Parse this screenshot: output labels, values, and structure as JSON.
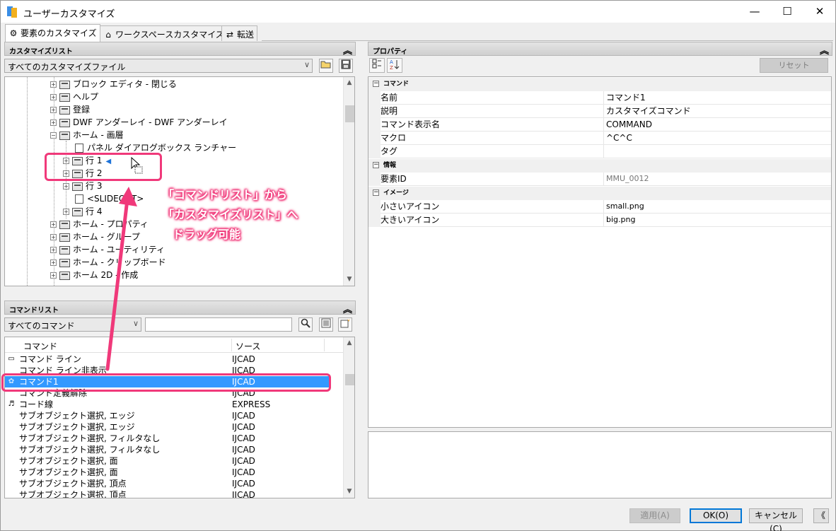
{
  "window": {
    "title": "ユーザーカスタマイズ",
    "min": "—",
    "max": "☐",
    "close": "✕"
  },
  "tabs": [
    {
      "label": "要素のカスタマイズ",
      "icon": "⚙"
    },
    {
      "label": "ワークスペースカスタマイズ",
      "icon": "⌂"
    },
    {
      "label": "転送",
      "icon": "⇄"
    }
  ],
  "customize_panel": {
    "title": "カスタマイズリスト",
    "collapse": "︽",
    "file_select": "すべてのカスタマイズファイル",
    "tree": [
      {
        "label": "ブロック エディタ - 閉じる",
        "pm": "+"
      },
      {
        "label": "ヘルプ",
        "pm": "+"
      },
      {
        "label": "登録",
        "pm": "+"
      },
      {
        "label": "DWF アンダーレイ - DWF アンダーレイ",
        "pm": "+"
      },
      {
        "label": "ホーム - 画層",
        "pm": "−"
      },
      {
        "label": "パネル ダイアログボックス ランチャー",
        "pm": ""
      },
      {
        "label": "行 1",
        "pm": "+"
      },
      {
        "label": "行 2",
        "pm": "+"
      },
      {
        "label": "行 3",
        "pm": "+"
      },
      {
        "label": "<SLIDEOUT>",
        "pm": ""
      },
      {
        "label": "行 4",
        "pm": "+"
      },
      {
        "label": "ホーム - プロパティ",
        "pm": "+"
      },
      {
        "label": "ホーム - グループ",
        "pm": "+"
      },
      {
        "label": "ホーム - ユーティリティ",
        "pm": "+"
      },
      {
        "label": "ホーム - クリップボード",
        "pm": "+"
      },
      {
        "label": "ホーム 2D - 作成",
        "pm": "+"
      }
    ]
  },
  "command_panel": {
    "title": "コマンドリスト",
    "collapse": "︽",
    "filter": "すべてのコマンド",
    "search_value": "",
    "columns": {
      "command": "コマンド",
      "source": "ソース"
    },
    "rows": [
      {
        "name": "コマンド ライン",
        "source": "IJCAD",
        "icon": "▭"
      },
      {
        "name": "コマンド ライン非表示",
        "source": "IJCAD",
        "icon": ""
      },
      {
        "name": "コマンド1",
        "source": "IJCAD",
        "icon": "✿",
        "selected": true
      },
      {
        "name": "コマンド定義解除",
        "source": "IJCAD",
        "icon": ""
      },
      {
        "name": "コード線",
        "source": "EXPRESS",
        "icon": "♬"
      },
      {
        "name": "サブオブジェクト選択, エッジ",
        "source": "IJCAD",
        "icon": ""
      },
      {
        "name": "サブオブジェクト選択, エッジ",
        "source": "IJCAD",
        "icon": ""
      },
      {
        "name": "サブオブジェクト選択, フィルタなし",
        "source": "IJCAD",
        "icon": ""
      },
      {
        "name": "サブオブジェクト選択, フィルタなし",
        "source": "IJCAD",
        "icon": ""
      },
      {
        "name": "サブオブジェクト選択, 面",
        "source": "IJCAD",
        "icon": ""
      },
      {
        "name": "サブオブジェクト選択, 面",
        "source": "IJCAD",
        "icon": ""
      },
      {
        "name": "サブオブジェクト選択, 頂点",
        "source": "IJCAD",
        "icon": ""
      },
      {
        "name": "サブオブジェクト選択, 頂点",
        "source": "IJCAD",
        "icon": ""
      }
    ]
  },
  "properties_panel": {
    "title": "プロパティ",
    "collapse": "︽",
    "reset": "リセット",
    "sections": [
      {
        "title": "コマンド",
        "rows": [
          {
            "key": "名前",
            "value": "コマンド1"
          },
          {
            "key": "説明",
            "value": "カスタマイズコマンド"
          },
          {
            "key": "コマンド表示名",
            "value": "COMMAND"
          },
          {
            "key": "マクロ",
            "value": "^C^C"
          },
          {
            "key": "タグ",
            "value": ""
          }
        ]
      },
      {
        "title": "情報",
        "rows": [
          {
            "key": "要素ID",
            "value": "MMU_0012",
            "readonly": true
          }
        ]
      },
      {
        "title": "イメージ",
        "rows": [
          {
            "key": "小さいアイコン",
            "value": "small.png"
          },
          {
            "key": "大きいアイコン",
            "value": "big.png"
          }
        ]
      }
    ]
  },
  "buttons": {
    "apply": "適用(A)",
    "ok": "OK(O)",
    "cancel": "キャンセル(C)",
    "collapse": "《"
  },
  "annotation": {
    "line1": "「コマンドリスト」から",
    "line2": "「カスタマイズリスト」へ",
    "line3": "ドラッグ可能"
  },
  "colors": {
    "annotation": "#f0397a",
    "selection": "#3399ff"
  }
}
